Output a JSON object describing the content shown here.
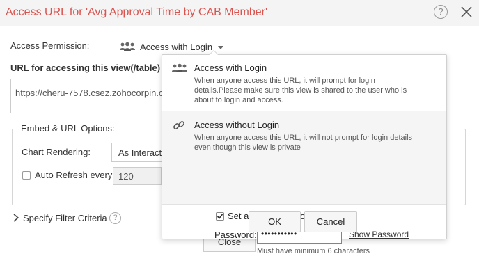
{
  "window": {
    "title": "Access URL for 'Avg Approval Time by CAB Member'",
    "help_glyph": "?",
    "accent_color": "#d9534f"
  },
  "access": {
    "label": "Access Permission:",
    "selected": "Access with Login",
    "icon": "users-icon"
  },
  "url": {
    "label": "URL for accessing this view(/table) inde",
    "value": "https://cheru-7578.csez.zohocorpin.c"
  },
  "embed": {
    "legend": "Embed & URL Options:",
    "chart_rendering_label": "Chart Rendering:",
    "chart_rendering_value": "As Interact",
    "auto_refresh_label": "Auto Refresh every",
    "auto_refresh_value": "120"
  },
  "filter": {
    "label": "Specify Filter Criteria",
    "help_glyph": "?"
  },
  "footer": {
    "close_label": "Close"
  },
  "popup": {
    "options": [
      {
        "title": "Access with Login",
        "icon": "users-icon",
        "description": "When anyone access this URL, it will prompt for login details.Please make sure this view is shared to the user who is about to login and access."
      },
      {
        "title": "Access without Login",
        "icon": "link-icon",
        "description": "When anyone access this URL, it will not prompt for login details even though this view is private"
      }
    ],
    "set_password_label": "Set access password",
    "set_password_checked": true,
    "help_glyph": "?",
    "password_label": "Password:",
    "password_value": "•••••••••••",
    "show_password_label": "Show Password",
    "password_hint": "Must have minimum 6 characters",
    "ok_label": "OK",
    "cancel_label": "Cancel"
  }
}
